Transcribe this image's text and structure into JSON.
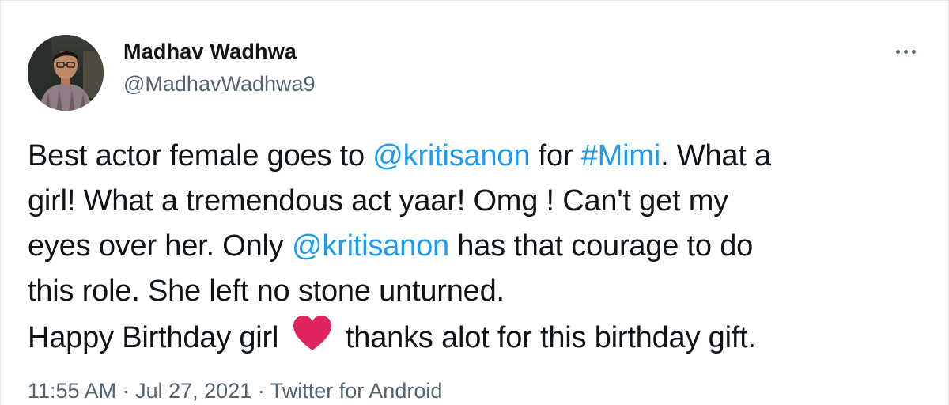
{
  "user": {
    "name": "Madhav Wadhwa",
    "handle": "@MadhavWadhwa9"
  },
  "tweet": {
    "lines": [
      [
        {
          "text": "Best actor female goes to ",
          "type": "text"
        },
        {
          "text": "@kritisanon",
          "type": "mention"
        },
        {
          "text": " for ",
          "type": "text"
        },
        {
          "text": "#Mimi",
          "type": "hashtag"
        },
        {
          "text": ". What a",
          "type": "text"
        }
      ],
      [
        {
          "text": "girl! What a tremendous act yaar! Omg ! Can't get my",
          "type": "text"
        }
      ],
      [
        {
          "text": "eyes over her. Only ",
          "type": "text"
        },
        {
          "text": "@kritisanon",
          "type": "mention"
        },
        {
          "text": " has that courage to do",
          "type": "text"
        }
      ],
      [
        {
          "text": "this role. She left no stone unturned.",
          "type": "text"
        }
      ],
      [
        {
          "text": "Happy Birthday girl ",
          "type": "text"
        },
        {
          "text": "heart-emoji",
          "type": "emoji"
        },
        {
          "text": " thanks alot for this birthday gift.",
          "type": "text"
        }
      ]
    ]
  },
  "meta": {
    "time": "11:55 AM",
    "separator": "·",
    "date": "Jul 27, 2021",
    "source": "Twitter for Android"
  },
  "colors": {
    "link": "#1d9bf0",
    "secondary_text": "#536471",
    "heart": "#e0245e"
  },
  "icons": {
    "more": "more-options-icon",
    "heart": "heart-emoji"
  }
}
